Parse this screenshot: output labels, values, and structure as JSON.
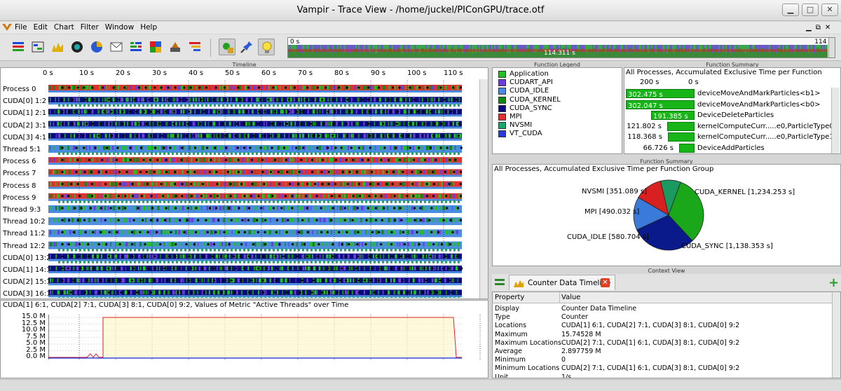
{
  "window": {
    "title": "Vampir - Trace View - /home/juckel/PIConGPU/trace.otf"
  },
  "menu": [
    "File",
    "Edit",
    "Chart",
    "Filter",
    "Window",
    "Help"
  ],
  "overview": {
    "start": "0 s",
    "end": "114 s",
    "center": "114.311 s"
  },
  "timeline": {
    "title": "Timeline",
    "ticks": [
      "0 s",
      "10 s",
      "20 s",
      "30 s",
      "40 s",
      "50 s",
      "60 s",
      "70 s",
      "80 s",
      "90 s",
      "100 s",
      "110 s"
    ],
    "rows": [
      "Process 0",
      "CUDA[0] 1:2",
      "CUDA[1] 2:1",
      "CUDA[2] 3:1",
      "CUDA[3] 4:1",
      "Thread 5:1",
      "Process 6",
      "Process 7",
      "Process 8",
      "Process 9",
      "Thread 9:3",
      "Thread 10:2",
      "Thread 11:2",
      "Thread 12:2",
      "CUDA[0] 13:2",
      "CUDA[1] 14:1",
      "CUDA[2] 15:1",
      "CUDA[3] 16:1"
    ]
  },
  "counter": {
    "title": "CUDA[1] 6:1, CUDA[2] 7:1, CUDA[3] 8:1, CUDA[0] 9:2, Values of Metric \"Active Threads\" over Time",
    "yticks": [
      "15.0 M",
      "12.5 M",
      "10.0 M",
      "7.5 M",
      "5.0 M",
      "2.5 M",
      "0.0 M"
    ]
  },
  "function_legend": {
    "title": "Function Legend",
    "items": [
      {
        "label": "Application",
        "color": "#22c022"
      },
      {
        "label": "CUDART_API",
        "color": "#6a3fd8"
      },
      {
        "label": "CUDA_IDLE",
        "color": "#4a8ae0"
      },
      {
        "label": "CUDA_KERNEL",
        "color": "#118811"
      },
      {
        "label": "CUDA_SYNC",
        "color": "#0a0a80"
      },
      {
        "label": "MPI",
        "color": "#e03030"
      },
      {
        "label": "NVSMI",
        "color": "#1aa86a"
      },
      {
        "label": "VT_CUDA",
        "color": "#2a3ad8"
      }
    ]
  },
  "function_summary": {
    "title": "Function Summary",
    "heading": "All Processes, Accumulated Exclusive Time per Function",
    "axis": [
      "200 s",
      "0 s"
    ],
    "rows": [
      {
        "value": "302.475 s",
        "label": "deviceMoveAndMarkParticles<b1>",
        "frac": 1.0
      },
      {
        "value": "302.047 s",
        "label": "deviceMoveAndMarkParticles<b0>",
        "frac": 0.998
      },
      {
        "value": "191.385 s",
        "label": "DeviceDeleteParticles",
        "frac": 0.633
      },
      {
        "value": "121.802 s",
        "label": "kernelComputeCurr.....e0,ParticleType0>",
        "frac": 0.403
      },
      {
        "value": "118.368 s",
        "label": "kernelComputeCurr.....e0,ParticleType1>",
        "frac": 0.391
      },
      {
        "value": "66.726 s",
        "label": "DeviceAddParticles",
        "frac": 0.221
      }
    ]
  },
  "group_summary": {
    "title": "Function Summary",
    "heading": "All Processes, Accumulated Exclusive Time per Function Group",
    "labels": {
      "nvsmi": "NVSMI [351.089 s]",
      "mpi": "MPI [490.032 s]",
      "idle": "CUDA_IDLE [580.704 s]",
      "kernel": "CUDA_KERNEL [1,234.253 s]",
      "sync": "CUDA_SYNC [1,138.353 s]"
    },
    "slices": [
      {
        "name": "CUDA_KERNEL",
        "value": 1234.253,
        "color": "#1aa81a"
      },
      {
        "name": "CUDA_SYNC",
        "value": 1138.353,
        "color": "#0a1a8a"
      },
      {
        "name": "CUDA_IDLE",
        "value": 580.704,
        "color": "#3a7ad8"
      },
      {
        "name": "MPI",
        "value": 490.032,
        "color": "#d82020"
      },
      {
        "name": "NVSMI",
        "value": 351.089,
        "color": "#1a9a60"
      }
    ]
  },
  "context": {
    "title": "Context View",
    "tab": "Counter Data Timeline",
    "headers": [
      "Property",
      "Value"
    ],
    "rows": [
      [
        "Display",
        "Counter Data Timeline"
      ],
      [
        "Type",
        "Counter"
      ],
      [
        "Locations",
        "CUDA[1] 6:1, CUDA[2] 7:1, CUDA[3] 8:1, CUDA[0] 9:2"
      ],
      [
        "Maximum",
        "15.74528 M"
      ],
      [
        "Maximum Locations",
        "CUDA[2] 7:1, CUDA[1] 6:1, CUDA[3] 8:1, CUDA[0] 9:2"
      ],
      [
        "Average",
        "2.897759 M"
      ],
      [
        "Minimum",
        "0"
      ],
      [
        "Minimum Locations",
        "CUDA[2] 7:1, CUDA[1] 6:1, CUDA[3] 8:1, CUDA[0] 9:2"
      ],
      [
        "Unit",
        "1/s"
      ]
    ]
  }
}
